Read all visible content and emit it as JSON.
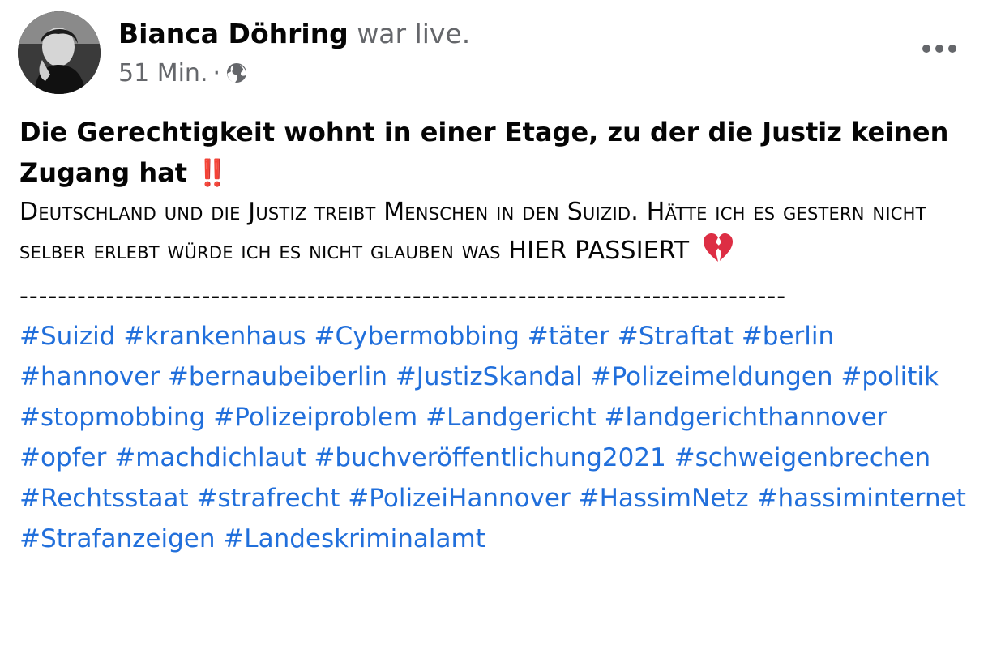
{
  "post": {
    "author": "Bianca Döhring",
    "status": "war live.",
    "time": "51 Min.",
    "separator": "·",
    "privacy_icon": "globe-icon",
    "more_icon": "more-options-icon",
    "title_text": "Die Gerechtigkeit wohnt in einer Etage, zu der die Justiz keinen Zugang hat",
    "title_emoji": "‼️",
    "text_main": "Deutschland und die Justiz treibt Menschen in den Suizid. Hätte ich es gestern nicht selber erlebt würde ich es nicht glauben was ",
    "text_tail": "HIER PASSIERT",
    "text_emoji": "broken-heart-icon",
    "divider": "--------------------------------------------------------------------------------",
    "hashtags": [
      "#Suizid",
      "#krankenhaus",
      "#Cybermobbing",
      "#täter",
      "#Straftat",
      "#berlin",
      "#hannover",
      "#bernaubeiberlin",
      "#JustizSkandal",
      "#Polizeimeldungen",
      "#politik",
      "#stopmobbing",
      "#Polizeiproblem",
      "#Landgericht",
      "#landgerichthannover",
      "#opfer",
      "#machdichlaut",
      "#buchveröffentlichung2021",
      "#schweigenbrechen",
      "#Rechtsstaat",
      "#strafrecht",
      "#PolizeiHannover",
      "#HassimNetz",
      "#hassiminternet",
      "#Strafanzeigen",
      "#Landeskriminalamt"
    ]
  },
  "colors": {
    "link": "#216fdb",
    "meta": "#65676b",
    "text": "#050505",
    "heart": "#dd2e44"
  }
}
